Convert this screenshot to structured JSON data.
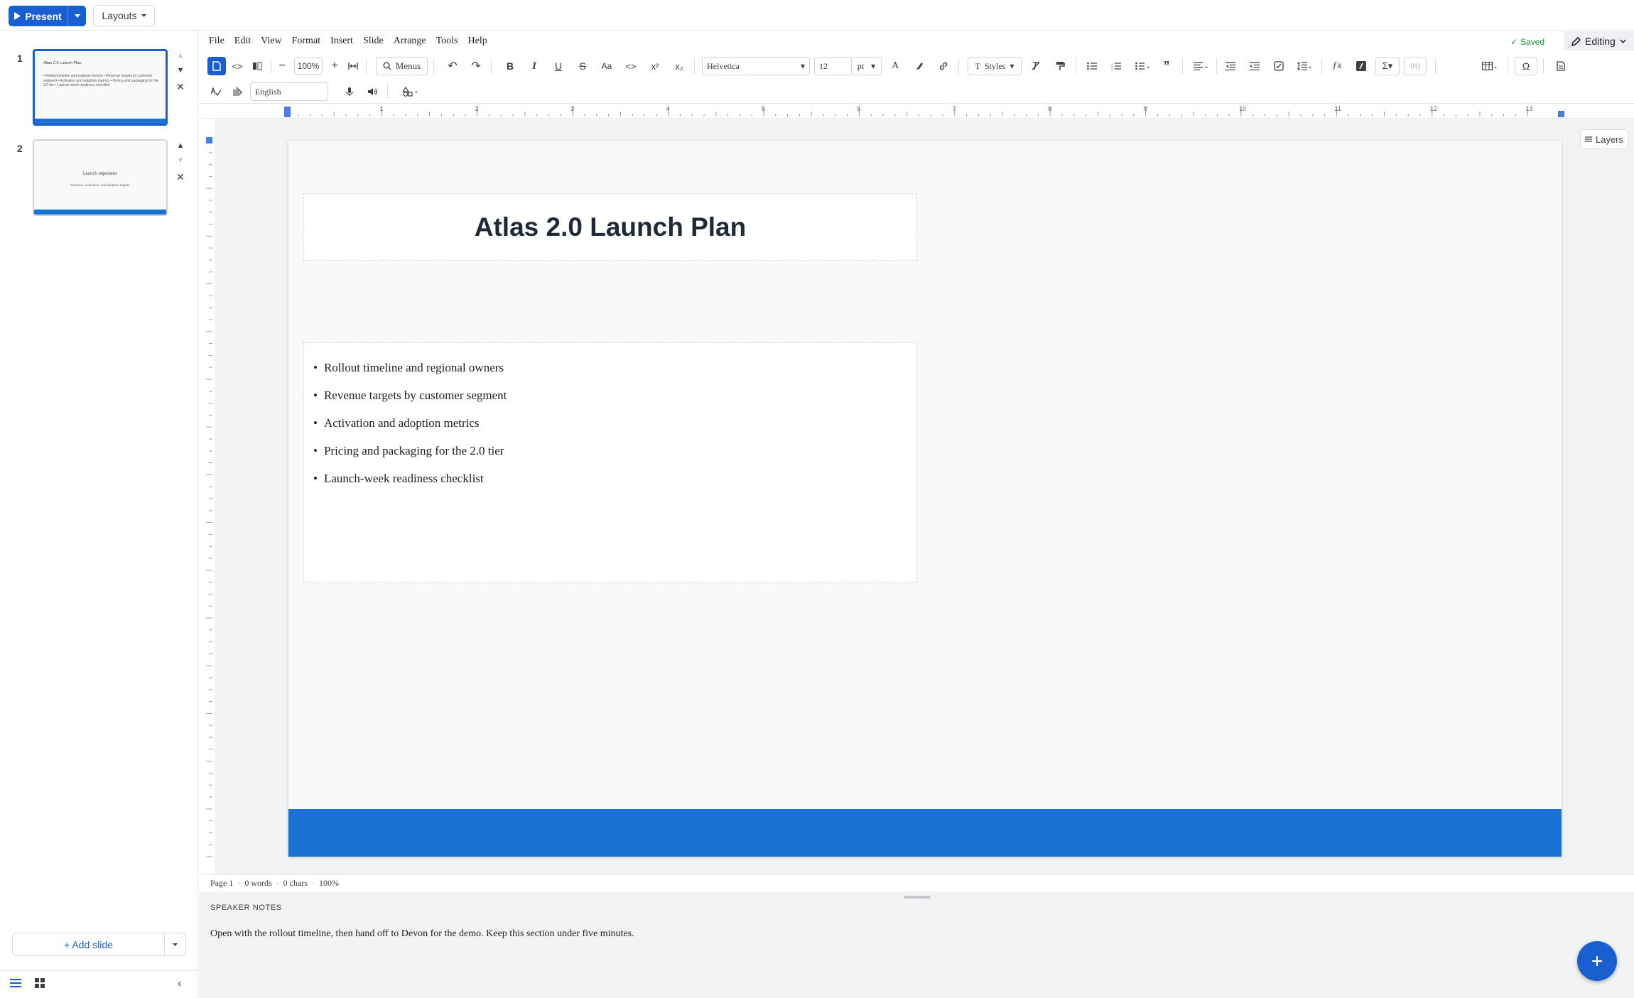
{
  "topbar": {
    "present_label": "Present",
    "layouts_label": "Layouts"
  },
  "slides": [
    {
      "number": "1",
      "title": "Atlas 2.0 Launch Plan",
      "body": "• Rollout timeline and regional owners • Revenue targets by customer segment • Activation and adoption metrics • Pricing and packaging for the 2.0 tier • Launch-week readiness checklist"
    },
    {
      "number": "2",
      "title": "Launch objectives",
      "subtitle": "Revenue, activation, and adoption targets"
    }
  ],
  "sidebar": {
    "add_slide_label": "+ Add slide"
  },
  "menu": [
    "File",
    "Edit",
    "View",
    "Format",
    "Insert",
    "Slide",
    "Arrange",
    "Tools",
    "Help"
  ],
  "status_right": {
    "saved": "Saved",
    "mode": "Editing"
  },
  "toolbar": {
    "zoom": "100%",
    "menus_label": "Menus",
    "font": "Helvetica",
    "font_size": "12",
    "unit": "pt",
    "styles_label": "Styles",
    "language": "English"
  },
  "ruler": {
    "labels": [
      "1",
      "2",
      "3",
      "4",
      "5",
      "6",
      "7",
      "8",
      "9",
      "10",
      "11",
      "12",
      "13"
    ]
  },
  "layers_label": "Layers",
  "slide": {
    "title": "Atlas 2.0 Launch Plan",
    "bullets": [
      "Rollout timeline and regional owners",
      "Revenue targets by customer segment",
      "Activation and adoption metrics",
      "Pricing and packaging for the 2.0 tier",
      "Launch-week readiness checklist"
    ]
  },
  "status": {
    "page": "Page 1",
    "words": "0 words",
    "chars": "0 chars",
    "zoom": "100%"
  },
  "notes": {
    "heading": "SPEAKER NOTES",
    "text": "Open with the rollout timeline, then hand off to Devon for the demo. Keep this section under five minutes."
  },
  "colors": {
    "accent": "#1a5fd1",
    "slide_bar": "#1a73d2",
    "saved": "#1e8e3e"
  }
}
